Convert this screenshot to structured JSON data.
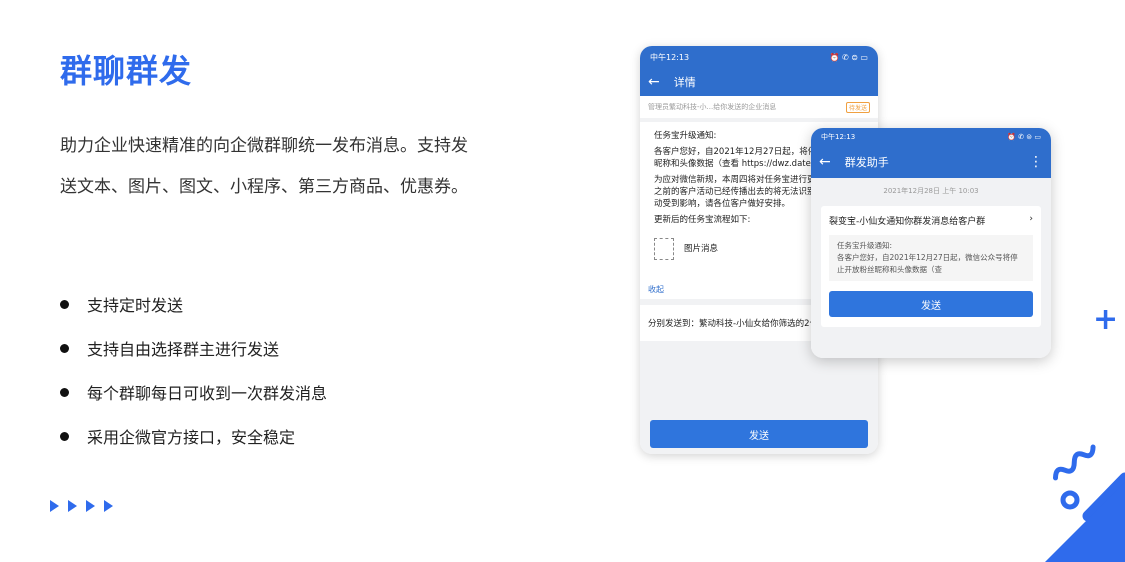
{
  "title": "群聊群发",
  "description": "助力企业快速精准的向企微群聊统一发布消息。支持发送文本、图片、图文、小程序、第三方商品、优惠券。",
  "bullets": [
    "支持定时发送",
    "支持自由选择群主进行发送",
    "每个群聊每日可收到一次群发消息",
    "采用企微官方接口，安全稳定"
  ],
  "colors": {
    "accent": "#2f6bec",
    "phone_header": "#2f6ecc",
    "button": "#2f75dd"
  },
  "phone1": {
    "status_time": "中午12:13",
    "status_icons": "⏰ ✆ ⊜ ▭",
    "back_icon": "←",
    "nav_title": "详情",
    "sender_line": "管理员繁动科技-小...给你发送的企业消息",
    "sender_tag": "待发送",
    "notice_title": "任务宝升级通知:",
    "notice_p1": "各客户您好，自2021年12月27日起，将停止开放粉丝昵称和头像数据（查看 https://dwz.date/fkNe）。",
    "notice_p2": "为应对微信新规，本周四将对任务宝进行更新，更新后之前的客户活动已经传播出去的将无法识别，为避免活动受到影响，请各位客户做好安排。",
    "notice_p3": "更新后的任务宝流程如下:",
    "image_label": "图片消息",
    "collapse": "收起",
    "distribute_to": "分别发送到：繁动科技-小仙女给你筛选的2个客户群",
    "send_label": "发送"
  },
  "phone2": {
    "status_time": "中午12:13",
    "status_icons": "⏰ ✆ ⊜ ▭",
    "back_icon": "←",
    "nav_title": "群发助手",
    "more_icon": "⋮",
    "timestamp": "2021年12月28日 上午 10:03",
    "card_title": "裂变宝-小仙女通知你群发消息给客户群",
    "card_chevron": "›",
    "card_body_title": "任务宝升级通知:",
    "card_body": "各客户您好，自2021年12月27日起，微信公众号将停止开放粉丝昵称和头像数据（查",
    "send_label": "发送"
  },
  "decor": {
    "plus_icon": "+"
  }
}
